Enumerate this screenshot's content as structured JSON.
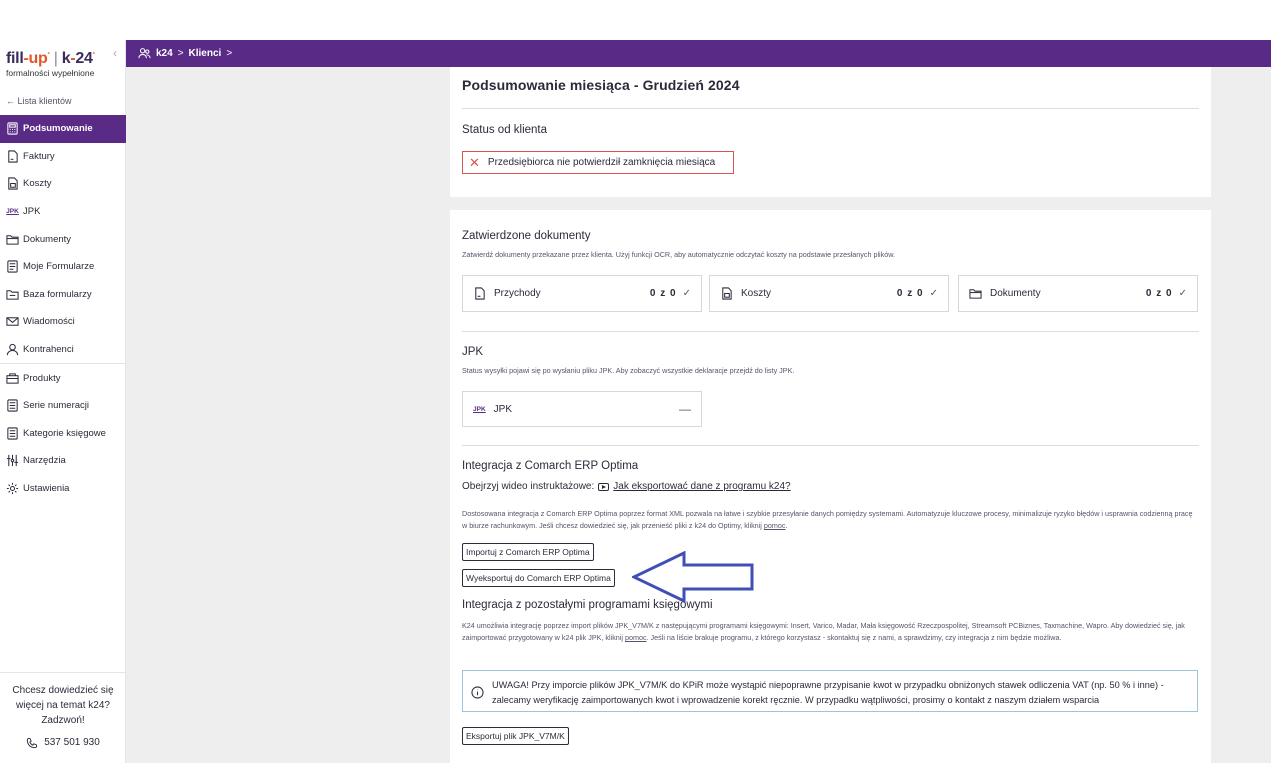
{
  "sidebar": {
    "logo": {
      "fill": "fill",
      "up": "-up",
      "sep": "|",
      "k": "k",
      "dash": "-",
      "n24": "24",
      "tagline": "formalności wypełnione"
    },
    "back_link": "← Lista klientów",
    "items": [
      {
        "label": "Podsumowanie",
        "icon": "calculator-icon",
        "active": true
      },
      {
        "label": "Faktury",
        "icon": "invoice-icon"
      },
      {
        "label": "Koszty",
        "icon": "costs-icon"
      },
      {
        "label": "JPK",
        "icon": "jpk-icon",
        "icon_text": "JPK"
      },
      {
        "label": "Dokumenty",
        "icon": "folder-icon"
      },
      {
        "label": "Moje Formularze",
        "icon": "form-icon"
      },
      {
        "label": "Baza formularzy",
        "icon": "forms-base-icon"
      },
      {
        "label": "Wiadomości",
        "icon": "mail-icon"
      },
      {
        "label": "Kontrahenci",
        "icon": "user-icon"
      },
      {
        "label": "Produkty",
        "icon": "box-icon"
      },
      {
        "label": "Serie numeracji",
        "icon": "list-icon"
      },
      {
        "label": "Kategorie księgowe",
        "icon": "list-icon"
      },
      {
        "label": "Narzędzia",
        "icon": "tools-icon"
      },
      {
        "label": "Ustawienia",
        "icon": "gear-icon"
      }
    ],
    "help": {
      "line1": "Chcesz dowiedzieć się",
      "line2": "więcej na temat k24?",
      "line3": "Zadzwoń!",
      "phone": "537 501 930"
    }
  },
  "breadcrumb": {
    "item1": "k24",
    "sep1": ">",
    "item2": "Klienci",
    "sep2": ">"
  },
  "summary": {
    "title": "Podsumowanie miesiąca - Grudzień 2024",
    "status_title": "Status od klienta",
    "status_alert": "Przedsiębiorca nie potwierdził zamknięcia miesiąca"
  },
  "approved": {
    "title": "Zatwierdzone dokumenty",
    "desc": "Zatwierdź dokumenty przekazane przez klienta. Użyj funkcji OCR, aby automatycznie odczytać koszty na podstawie przesłanych plików.",
    "boxes": [
      {
        "label": "Przychody",
        "count": "0 z 0",
        "check": "✓"
      },
      {
        "label": "Koszty",
        "count": "0 z 0",
        "check": "✓"
      },
      {
        "label": "Dokumenty",
        "count": "0 z 0",
        "check": "✓"
      }
    ]
  },
  "jpk": {
    "title": "JPK",
    "desc": "Status wysyłki pojawi się po wysłaniu pliku JPK. Aby zobaczyć wszystkie deklaracje przejdź do listy JPK.",
    "box_label": "JPK",
    "box_value": "—"
  },
  "optima": {
    "title": "Integracja z Comarch ERP Optima",
    "video_prefix": "Obejrzyj wideo instruktażowe:",
    "video_link": "Jak eksportować dane z programu k24?",
    "desc": "Dostosowana integracja z Comarch ERP Optima poprzez format XML pozwala na łatwe i szybkie przesyłanie danych pomiędzy systemami. Automatyzuje kluczowe procesy, minimalizuje ryzyko błędów i usprawnia codzienną pracę w biurze rachunkowym. Jeśli chcesz dowiedzieć się, jak przenieść pliki z k24 do Optimy, kliknij ",
    "desc_link": "pomoc",
    "desc_end": ".",
    "import_btn": "Importuj z Comarch ERP Optima",
    "export_btn": "Wyeksportuj do Comarch ERP Optima"
  },
  "others": {
    "title": "Integracja z pozostałymi programami księgowymi",
    "desc": "K24 umożliwia integrację poprzez import plików JPK_V7M/K z następującymi programami księgowymi: Insert, Varico, Madar, Mała księgowość Rzeczpospolitej, Streamsoft PCBiznes, Taxmachine, Wapro. Aby dowiedzieć się, jak zaimportować przygotowany w k24 plik JPK, kliknij ",
    "desc_link": "pomoc",
    "desc_end": ". Jeśli na liście brakuje programu, z którego korzystasz - skontaktuj się z nami, a sprawdzimy, czy integracja z nim będzie możliwa.",
    "warning": "UWAGA! Przy imporcie plików JPK_V7M/K do KPiR może wystąpić niepoprawne przypisanie kwot w przypadku obniżonych stawek odliczenia VAT (np. 50 % i inne) - zalecamy weryfikację zaimportowanych kwot i wprowadzenie korekt ręcznie. W przypadku wątpliwości, prosimy o kontakt z naszym działem wsparcia",
    "export_btn": "Eksportuj plik JPK_V7M/K"
  },
  "colors": {
    "brand": "#5a2b86",
    "accent": "#e3562a",
    "alert": "#d9534f",
    "annotation_arrow": "#3f4fb5"
  }
}
